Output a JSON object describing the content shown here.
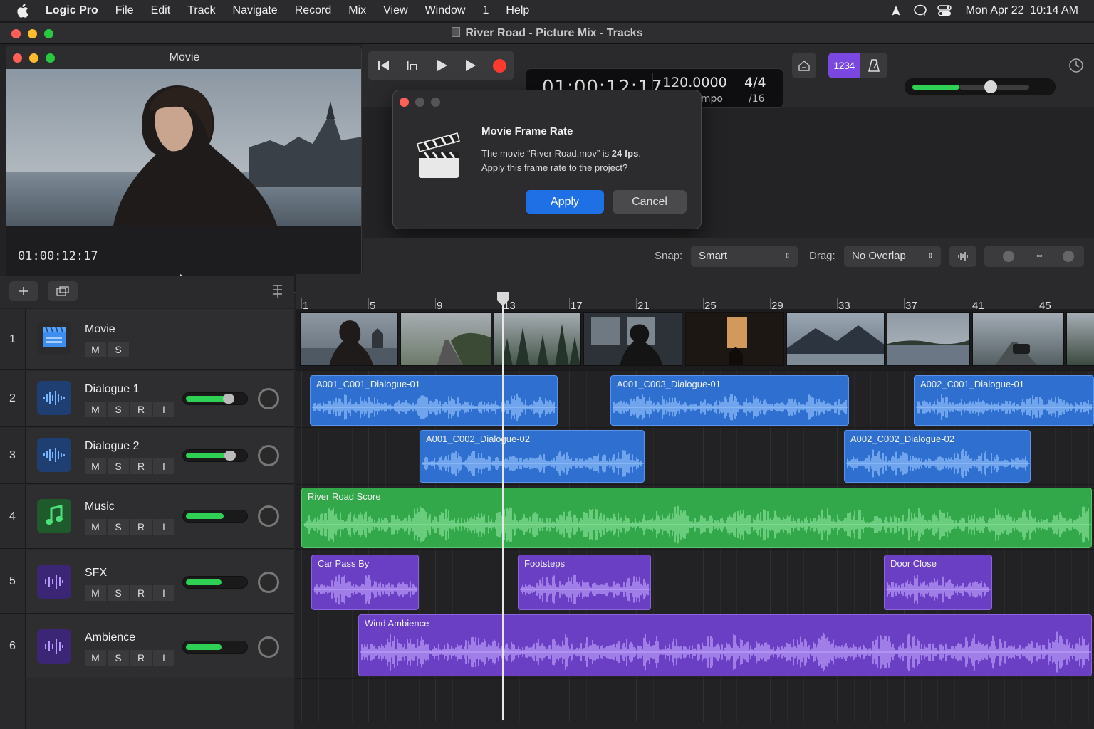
{
  "menubar": {
    "app_name": "Logic Pro",
    "items": [
      "File",
      "Edit",
      "Track",
      "Navigate",
      "Record",
      "Mix",
      "View",
      "Window",
      "1",
      "Help"
    ],
    "clock": "Mon Apr 22  10:14 AM"
  },
  "window": {
    "title": "River Road - Picture Mix - Tracks"
  },
  "transport": {
    "timecode": "01:00:12:17",
    "tempo": "120.0000",
    "tempo_mode": "Keep Tempo",
    "signature": "4/4",
    "division": "/16",
    "count_in_label": "1234",
    "record_color": "#ff3b30",
    "master_volume_fraction": 0.62
  },
  "movie_window": {
    "title": "Movie",
    "timecode": "01:00:12:17"
  },
  "dialog": {
    "title": "Movie Frame Rate",
    "message_prefix": "The movie “River Road.mov” is ",
    "message_bold": "24 fps",
    "message_suffix": ".",
    "message_line2": "Apply this frame rate to the project?",
    "apply_label": "Apply",
    "cancel_label": "Cancel"
  },
  "toolbar": {
    "snap_label": "Snap:",
    "snap_value": "Smart",
    "drag_label": "Drag:",
    "drag_value": "No Overlap"
  },
  "ruler": {
    "bars": [
      "1",
      "5",
      "9",
      "13",
      "17",
      "21",
      "25",
      "29",
      "33",
      "37",
      "41",
      "45"
    ]
  },
  "tracks": [
    {
      "num": "1",
      "name": "Movie",
      "icon": "movie-icon",
      "buttons": [
        "M",
        "S"
      ]
    },
    {
      "num": "2",
      "name": "Dialogue 1",
      "icon": "waveform-icon",
      "buttons": [
        "M",
        "S",
        "R",
        "I"
      ],
      "volume": 0.75
    },
    {
      "num": "3",
      "name": "Dialogue 2",
      "icon": "waveform-icon",
      "buttons": [
        "M",
        "S",
        "R",
        "I"
      ],
      "volume": 0.78
    },
    {
      "num": "4",
      "name": "Music",
      "icon": "music-note-icon",
      "buttons": [
        "M",
        "S",
        "R",
        "I"
      ],
      "volume": 0.66
    },
    {
      "num": "5",
      "name": "SFX",
      "icon": "waveform-icon",
      "buttons": [
        "M",
        "S",
        "R",
        "I"
      ],
      "volume": 0.62
    },
    {
      "num": "6",
      "name": "Ambience",
      "icon": "waveform-icon",
      "buttons": [
        "M",
        "S",
        "R",
        "I"
      ],
      "volume": 0.62
    }
  ],
  "regions": {
    "dialogue1": [
      "A001_C001_Dialogue-01",
      "A001_C003_Dialogue-01",
      "A002_C001_Dialogue-01"
    ],
    "dialogue2": [
      "A001_C002_Dialogue-02",
      "A002_C002_Dialogue-02"
    ],
    "music": [
      "River Road Score"
    ],
    "sfx": [
      "Car Pass By",
      "Footsteps",
      "Door Close"
    ],
    "ambience": [
      "Wind Ambience"
    ]
  },
  "colors": {
    "dialogue": "#2f6fcf",
    "music": "#33a84a",
    "sfx": "#6a3fc4",
    "apply_button": "#1f6fe5"
  }
}
